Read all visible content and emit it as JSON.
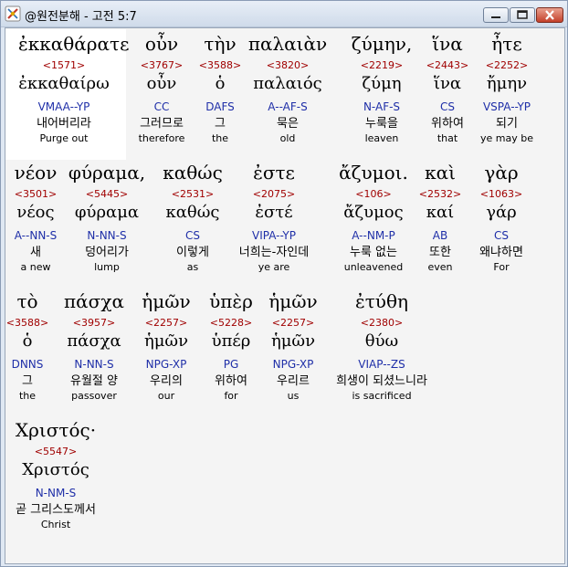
{
  "window": {
    "title": "@원전분해 - 고전 5:7",
    "icons": {
      "app": "app-icon",
      "minimize": "minimize-icon",
      "maximize": "maximize-icon",
      "close": "close-icon"
    }
  },
  "verse": {
    "lines": [
      [
        {
          "greek": "ἐκκαθάρατε",
          "strong": "<1571>",
          "lemma": "ἐκκαθαίρω",
          "parse": "VMAA--YP",
          "korean": "내어버리라",
          "english": "Purge out"
        },
        {
          "greek": "οὖν",
          "strong": "<3767>",
          "lemma": "οὖν",
          "parse": "CC",
          "korean": "그러므로",
          "english": "therefore"
        },
        {
          "greek": "τὴν",
          "strong": "<3588>",
          "lemma": "ὁ",
          "parse": "DAFS",
          "korean": "그",
          "english": "the"
        },
        {
          "greek": "παλαιὰν",
          "strong": "<3820>",
          "lemma": "παλαιός",
          "parse": "A--AF-S",
          "korean": "묵은",
          "english": "old"
        },
        {
          "greek": "ζύμην,",
          "strong": "<2219>",
          "lemma": "ζύμη",
          "parse": "N-AF-S",
          "korean": "누룩을",
          "english": "leaven"
        },
        {
          "greek": "ἵνα",
          "strong": "<2443>",
          "lemma": "ἵνα",
          "parse": "CS",
          "korean": "위하여",
          "english": "that"
        },
        {
          "greek": "ἦτε",
          "strong": "<2252>",
          "lemma": "ἤμην",
          "parse": "VSPA--YP",
          "korean": "되기",
          "english": "ye may be"
        }
      ],
      [
        {
          "greek": "νέον",
          "strong": "<3501>",
          "lemma": "νέος",
          "parse": "A--NN-S",
          "korean": "새",
          "english": "a new"
        },
        {
          "greek": "φύραμα,",
          "strong": "<5445>",
          "lemma": "φύραμα",
          "parse": "N-NN-S",
          "korean": "덩어리가",
          "english": "lump"
        },
        {
          "greek": "καθώς",
          "strong": "<2531>",
          "lemma": "καθώς",
          "parse": "CS",
          "korean": "이렇게",
          "english": "as"
        },
        {
          "greek": "ἐστε",
          "strong": "<2075>",
          "lemma": "ἐστέ",
          "parse": "VIPA--YP",
          "korean": "너희는-자인데",
          "english": "ye are"
        },
        {
          "greek": "ἄζυμοι.",
          "strong": "<106>",
          "lemma": "ἄζυμος",
          "parse": "A--NM-P",
          "korean": "누룩 없는",
          "english": "unleavened"
        },
        {
          "greek": "καὶ",
          "strong": "<2532>",
          "lemma": "καί",
          "parse": "AB",
          "korean": "또한",
          "english": "even"
        },
        {
          "greek": "γὰρ",
          "strong": "<1063>",
          "lemma": "γάρ",
          "parse": "CS",
          "korean": "왜냐하면",
          "english": "For"
        }
      ],
      [
        {
          "greek": "τὸ",
          "strong": "<3588>",
          "lemma": "ὁ",
          "parse": "DNNS",
          "korean": "그",
          "english": "the"
        },
        {
          "greek": "πάσχα",
          "strong": "<3957>",
          "lemma": "πάσχα",
          "parse": "N-NN-S",
          "korean": "유월절 양",
          "english": "passover"
        },
        {
          "greek": "ἡμῶν",
          "strong": "<2257>",
          "lemma": "ἡμῶν",
          "parse": "NPG-XP",
          "korean": "우리의",
          "english": "our"
        },
        {
          "greek": "ὑπὲρ",
          "strong": "<5228>",
          "lemma": "ὑπέρ",
          "parse": "PG",
          "korean": "위하여",
          "english": "for"
        },
        {
          "greek": "ἡμῶν",
          "strong": "<2257>",
          "lemma": "ἡμῶν",
          "parse": "NPG-XP",
          "korean": "우리르",
          "english": "us"
        },
        {
          "greek": "ἐτύθη",
          "strong": "<2380>",
          "lemma": "θύω",
          "parse": "VIAP--ZS",
          "korean": "희생이 되셨느니라",
          "english": "is sacrificed"
        }
      ],
      [
        {
          "greek": "Χριστός·",
          "strong": "<5547>",
          "lemma": "Χριστός",
          "parse": "N-NM-S",
          "korean": "곧 그리스도께서",
          "english": "Christ"
        }
      ]
    ]
  }
}
